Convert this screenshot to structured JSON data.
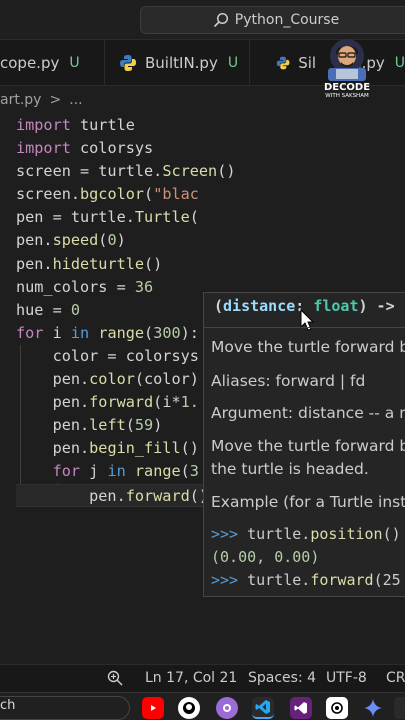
{
  "search": {
    "label": "Python_Course"
  },
  "tabs": [
    {
      "label": "cope.py",
      "status": "U"
    },
    {
      "label": "BuiltIN.py",
      "status": "U"
    },
    {
      "label": "Sil",
      "suffix": "e.py",
      "status": "U"
    }
  ],
  "channel": {
    "name": "DECODE",
    "sub": "WITH SAKSHAM"
  },
  "breadcrumb": {
    "file": "art.py",
    "sep": ">",
    "more": "..."
  },
  "code": [
    [
      [
        "kw",
        "import"
      ],
      [
        "var",
        " turtle"
      ]
    ],
    [
      [
        "kw",
        "import"
      ],
      [
        "var",
        " colorsys"
      ]
    ],
    [
      [
        "var",
        "screen = turtle."
      ],
      [
        "fn",
        "Screen"
      ],
      [
        "op",
        "()"
      ]
    ],
    [
      [
        "var",
        "screen."
      ],
      [
        "fn",
        "bgcolor"
      ],
      [
        "op",
        "("
      ],
      [
        "str",
        "\"blac"
      ]
    ],
    [
      [
        "var",
        "pen = turtle."
      ],
      [
        "fn",
        "Turtle"
      ],
      [
        "op",
        "("
      ]
    ],
    [
      [
        "var",
        "pen."
      ],
      [
        "fn",
        "speed"
      ],
      [
        "op",
        "("
      ],
      [
        "num",
        "0"
      ],
      [
        "op",
        ")"
      ]
    ],
    [
      [
        "var",
        "pen."
      ],
      [
        "fn",
        "hideturtle"
      ],
      [
        "op",
        "()"
      ]
    ],
    [
      [
        "var",
        "num_colors = "
      ],
      [
        "num",
        "36"
      ]
    ],
    [
      [
        "var",
        "hue = "
      ],
      [
        "num",
        "0"
      ]
    ],
    [
      [
        "kw",
        "for"
      ],
      [
        "var",
        " i "
      ],
      [
        "bl",
        "in"
      ],
      [
        "var",
        " "
      ],
      [
        "fn",
        "range"
      ],
      [
        "op",
        "("
      ],
      [
        "num",
        "300"
      ],
      [
        "op",
        "):"
      ]
    ],
    [
      [
        "var",
        "    color = colorsys"
      ]
    ],
    [
      [
        "var",
        "    pen."
      ],
      [
        "fn",
        "color"
      ],
      [
        "op",
        "(color)"
      ]
    ],
    [
      [
        "var",
        "    pen."
      ],
      [
        "fn",
        "forward"
      ],
      [
        "op",
        "(i*"
      ],
      [
        "num",
        "1."
      ]
    ],
    [
      [
        "var",
        "    pen."
      ],
      [
        "fn",
        "left"
      ],
      [
        "op",
        "("
      ],
      [
        "num",
        "59"
      ],
      [
        "op",
        ")"
      ]
    ],
    [
      [
        "var",
        "    pen."
      ],
      [
        "fn",
        "begin_fill"
      ],
      [
        "op",
        "()"
      ]
    ],
    [
      [
        "var",
        "    "
      ],
      [
        "kw",
        "for"
      ],
      [
        "var",
        " j "
      ],
      [
        "bl",
        "in"
      ],
      [
        "var",
        " "
      ],
      [
        "fn",
        "range"
      ],
      [
        "op",
        "("
      ],
      [
        "num",
        "3"
      ]
    ],
    [
      [
        "var",
        "        pen."
      ],
      [
        "fn",
        "forward"
      ],
      [
        "op",
        "()"
      ]
    ]
  ],
  "hover": {
    "sig_open": "(",
    "sig_param": "distance",
    "sig_colon": ": ",
    "sig_type": "float",
    "sig_close": ") ->",
    "desc1": "Move the turtle forward by",
    "aliases": "Aliases: forward | fd",
    "argument": "Argument: distance -- a nu",
    "desc2a": "Move the turtle forward by",
    "desc2b": "the turtle is headed.",
    "example": "Example (for a Turtle insta",
    "ex1_prompt": ">>>",
    "ex1_code": " turtle.",
    "ex1_fn": "position",
    "ex1_end": "()",
    "ex2": "(0.00, 0.00)",
    "ex3_prompt": ">>>",
    "ex3_code": " turtle.",
    "ex3_fn": "forward",
    "ex3_end": "(25"
  },
  "status": {
    "position": "Ln 17, Col 21",
    "spaces": "Spaces: 4",
    "encoding": "UTF-8",
    "eol": "CRL"
  },
  "taskbar": {
    "search_fragment": "ch"
  },
  "colors": {
    "keyword": "#c586c0",
    "function": "#dcdcaa",
    "string": "#ce9178",
    "number": "#b5cea8",
    "untracked": "#73c991"
  }
}
